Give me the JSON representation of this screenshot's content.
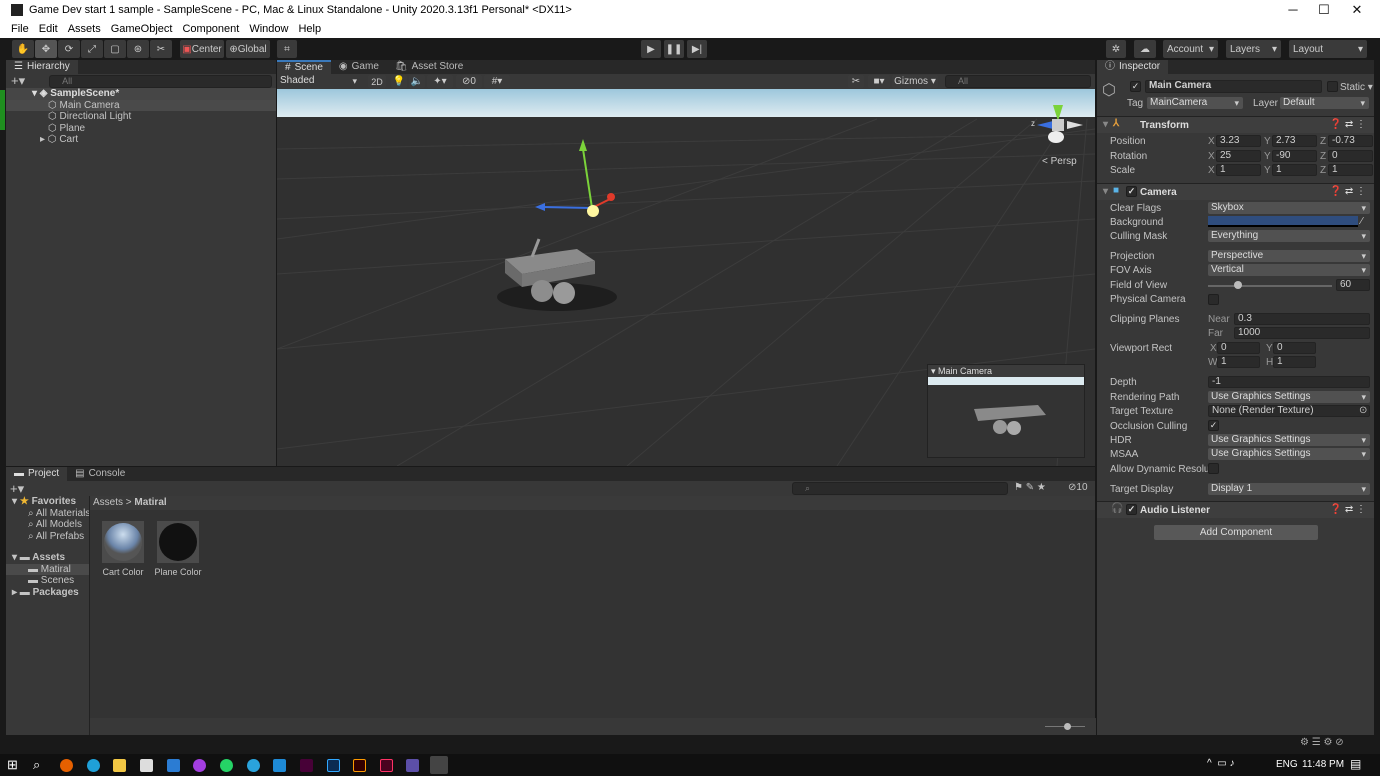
{
  "window": {
    "title": "Game Dev start 1 sample - SampleScene - PC, Mac & Linux Standalone - Unity 2020.3.13f1 Personal* <DX11>",
    "minimize": "─",
    "maximize": "☐",
    "close": "✕"
  },
  "menu": [
    "File",
    "Edit",
    "Assets",
    "GameObject",
    "Component",
    "Window",
    "Help"
  ],
  "toolbar": {
    "center": "Center",
    "global": "Global",
    "account": "Account",
    "layers": "Layers",
    "layout": "Layout"
  },
  "hierarchy": {
    "tab": "Hierarchy",
    "search_placeholder": "All",
    "scene": "SampleScene*",
    "items": [
      "Main Camera",
      "Directional Light",
      "Plane",
      "Cart"
    ]
  },
  "scene": {
    "tabs": [
      "Scene",
      "Game",
      "Asset Store"
    ],
    "shading": "Shaded",
    "mode_2d": "2D",
    "hidden_count": "0",
    "gizmos": "Gizmos",
    "search_placeholder": "All",
    "persp": "Persp",
    "axis_z": "z",
    "camera_preview_title": "Main Camera"
  },
  "inspector": {
    "tab": "Inspector",
    "object_name": "Main Camera",
    "static": "Static",
    "tag_label": "Tag",
    "tag": "MainCamera",
    "layer_label": "Layer",
    "layer": "Default",
    "transform": {
      "title": "Transform",
      "rows": [
        {
          "label": "Position",
          "x": "3.23",
          "y": "2.73",
          "z": "-0.73"
        },
        {
          "label": "Rotation",
          "x": "25",
          "y": "-90",
          "z": "0"
        },
        {
          "label": "Scale",
          "x": "1",
          "y": "1",
          "z": "1"
        }
      ]
    },
    "camera": {
      "title": "Camera",
      "clear_flags_label": "Clear Flags",
      "clear_flags": "Skybox",
      "background_label": "Background",
      "background_color": "#2f4d7e",
      "culling_mask_label": "Culling Mask",
      "culling_mask": "Everything",
      "projection_label": "Projection",
      "projection": "Perspective",
      "fov_axis_label": "FOV Axis",
      "fov_axis": "Vertical",
      "fov_label": "Field of View",
      "fov": "60",
      "fov_fraction": 0.24,
      "physical_label": "Physical Camera",
      "clipping_label": "Clipping Planes",
      "near_label": "Near",
      "near": "0.3",
      "far_label": "Far",
      "far": "1000",
      "viewport_label": "Viewport Rect",
      "vx": "0",
      "vy": "0",
      "vw": "1",
      "vh": "1",
      "depth_label": "Depth",
      "depth": "-1",
      "rendering_path_label": "Rendering Path",
      "rendering_path": "Use Graphics Settings",
      "target_texture_label": "Target Texture",
      "target_texture": "None (Render Texture)",
      "occlusion_label": "Occlusion Culling",
      "hdr_label": "HDR",
      "hdr": "Use Graphics Settings",
      "msaa_label": "MSAA",
      "msaa": "Use Graphics Settings",
      "dynres_label": "Allow Dynamic Resoluti",
      "target_display_label": "Target Display",
      "target_display": "Display 1"
    },
    "audio_listener": {
      "title": "Audio Listener"
    },
    "add_component": "Add Component"
  },
  "project": {
    "tabs": [
      "Project",
      "Console"
    ],
    "favorites": "Favorites",
    "favorite_items": [
      "All Materials",
      "All Models",
      "All Prefabs"
    ],
    "assets": "Assets",
    "asset_folders": [
      "Matiral",
      "Scenes"
    ],
    "packages": "Packages",
    "breadcrumb": [
      "Assets",
      "Matiral"
    ],
    "files": [
      "Cart Color",
      "Plane Color"
    ],
    "hidden_count": "10"
  },
  "taskbar": {
    "lang": "ENG",
    "time": "11:48 PM"
  }
}
